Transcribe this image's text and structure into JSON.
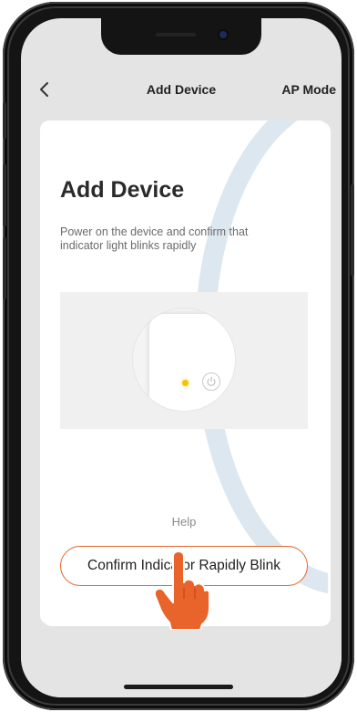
{
  "nav": {
    "back_icon": "chevron-left-icon",
    "title": "Add Device",
    "right_action": "AP Mode"
  },
  "card": {
    "title": "Add Device",
    "description": "Power on the device and confirm that indicator light blinks rapidly"
  },
  "illustration": {
    "led_icon": "indicator-light-icon",
    "power_icon": "power-button-icon"
  },
  "help": {
    "label": "Help"
  },
  "confirm_button": {
    "label": "Confirm Indicator Rapidly Blink"
  },
  "colors": {
    "accent": "#e0662b",
    "led": "#f5c400",
    "background": "#e4e4e4",
    "decoration": "#dde7f0"
  }
}
